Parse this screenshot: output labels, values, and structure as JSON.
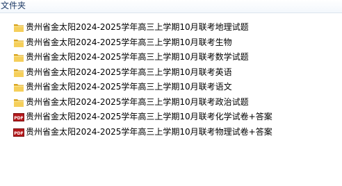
{
  "header": {
    "title": "文件夹"
  },
  "items": [
    {
      "name": "贵州省金太阳2024-2025学年高三上学期10月联考地理试题",
      "type": "folder",
      "icon": "folder-icon"
    },
    {
      "name": "贵州省金太阳2024-2025学年高三上学期10月联考生物",
      "type": "folder",
      "icon": "folder-icon"
    },
    {
      "name": "贵州省金太阳2024-2025学年高三上学期10月联考数学试题",
      "type": "folder",
      "icon": "folder-icon"
    },
    {
      "name": "贵州省金太阳2024-2025学年高三上学期10月联考英语",
      "type": "folder",
      "icon": "folder-icon"
    },
    {
      "name": "贵州省金太阳2024-2025学年高三上学期10月联考语文",
      "type": "folder",
      "icon": "folder-icon"
    },
    {
      "name": "贵州省金太阳2024-2025学年高三上学期10月联考政治试题",
      "type": "folder",
      "icon": "folder-icon"
    },
    {
      "name": "贵州省金太阳2024-2025学年高三上学期10月联考化学试卷+答案",
      "type": "pdf",
      "icon": "pdf-file-icon",
      "icon_text": "PDF"
    },
    {
      "name": "贵州省金太阳2024-2025学年高三上学期10月联考物理试卷+答案",
      "type": "pdf",
      "icon": "pdf-file-icon",
      "icon_text": "PDF"
    }
  ],
  "colors": {
    "folder": "#f2c94c",
    "folder_dark": "#d9a520",
    "pdf_red": "#b5181b"
  }
}
